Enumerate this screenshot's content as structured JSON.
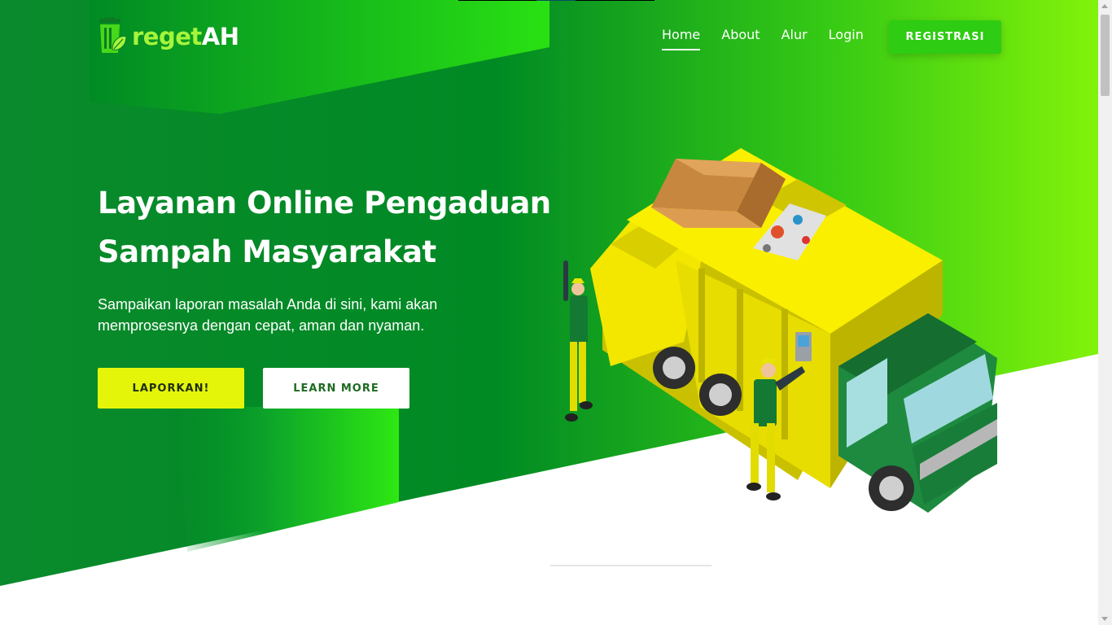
{
  "brand": {
    "name_part1": "reget",
    "name_part2": "AH",
    "icon": "trash-bin-leaf-icon"
  },
  "nav": {
    "items": [
      {
        "label": "Home",
        "active": true
      },
      {
        "label": "About",
        "active": false
      },
      {
        "label": "Alur",
        "active": false
      },
      {
        "label": "Login",
        "active": false
      }
    ],
    "register_label": "REGISTRASI"
  },
  "hero": {
    "title_line1": "Layanan Online Pengaduan",
    "title_line2": "Sampah Masyarakat",
    "subtitle_line1": "Sampaikan laporan masalah Anda di sini, kami akan",
    "subtitle_line2": "memprosesnya dengan cepat, aman dan nyaman.",
    "primary_button": "LAPORKAN!",
    "secondary_button": "LEARN MORE",
    "illustration": "garbage-truck-illustration"
  },
  "colors": {
    "hero_dark_green": "#0a8a2c",
    "hero_light_green": "#7ff00a",
    "accent_yellow": "#e5f50a",
    "register_button": "#2ecc12",
    "white": "#ffffff"
  }
}
